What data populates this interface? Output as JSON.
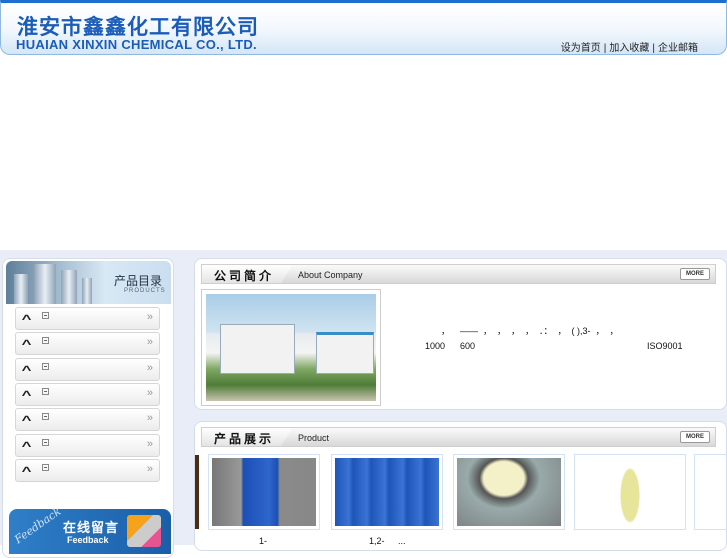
{
  "header": {
    "company_cn": "淮安市鑫鑫化工有限公司",
    "company_en": "HUAIAN XINXIN CHEMICAL CO., LTD.",
    "links": [
      "设为首页",
      "加入收藏",
      "企业邮箱"
    ],
    "separator": "|"
  },
  "categories": {
    "title": "产品目录",
    "subtitle": "PRODUCTS",
    "items": [
      "",
      "",
      "",
      "",
      "",
      "",
      ""
    ],
    "more_glyph": "»"
  },
  "feedback": {
    "title": "在线留言",
    "subtitle": "Feedback",
    "script": "Feedback"
  },
  "about": {
    "title": "公司简介",
    "subtitle": "About Company",
    "more": "MORE",
    "line1": "，    ——  ，  ，  ，  ，  ．：  ，  ( ),3-  ，  ，",
    "line2_a": "1000",
    "line2_b": "600",
    "line2_c": "ISO9001"
  },
  "products": {
    "title": "产品展示",
    "subtitle": "Product",
    "more": "MORE",
    "captions": [
      "1-",
      "1,2-",
      "...",
      "",
      ""
    ]
  },
  "colors": {
    "brand": "#1b5cb8",
    "top_border": "#1d6fd1",
    "background": "#e9edf7"
  }
}
